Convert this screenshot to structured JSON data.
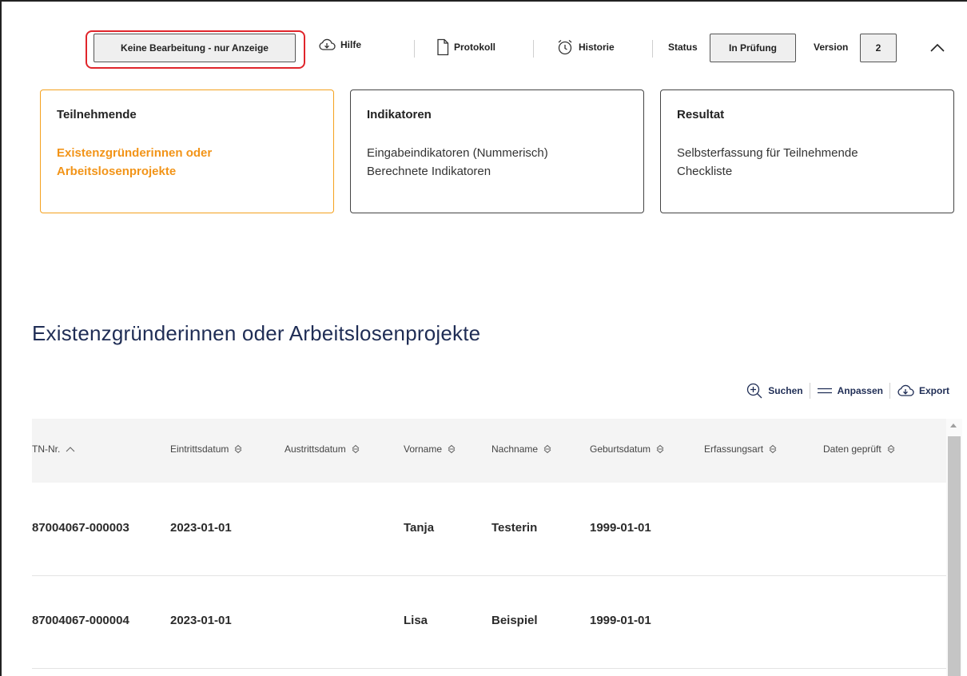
{
  "toolbar": {
    "mode_button": "Keine Bearbeitung - nur Anzeige",
    "help": "Hilfe",
    "protocol": "Protokoll",
    "history": "Historie",
    "status_label": "Status",
    "status_value": "In Prüfung",
    "version_label": "Version",
    "version_value": "2"
  },
  "cards": [
    {
      "title": "Teilnehmende",
      "links": [
        "Existenzgründerinnen oder Arbeitslosenprojekte"
      ],
      "active": true
    },
    {
      "title": "Indikatoren",
      "links": [
        "Eingabeindikatoren (Nummerisch)",
        "Berechnete Indikatoren"
      ],
      "active": false
    },
    {
      "title": "Resultat",
      "links": [
        "Selbsterfassung für Teilnehmende",
        "Checkliste"
      ],
      "active": false
    }
  ],
  "page_title": "Existenzgründerinnen oder Arbeitslosenprojekte",
  "table_actions": {
    "search": "Suchen",
    "customize": "Anpassen",
    "export": "Export"
  },
  "table": {
    "columns": [
      "TN-Nr.",
      "Eintrittsdatum",
      "Austrittsdatum",
      "Vorname",
      "Nachname",
      "Geburtsdatum",
      "Erfassungsart",
      "Daten geprüft"
    ],
    "rows": [
      [
        "87004067-000003",
        "2023-01-01",
        "",
        "Tanja",
        "Testerin",
        "1999-01-01",
        "",
        ""
      ],
      [
        "87004067-000004",
        "2023-01-01",
        "",
        "Lisa",
        "Beispiel",
        "1999-01-01",
        "",
        ""
      ]
    ]
  },
  "colors": {
    "accent": "#f29418",
    "navy": "#1f2d55",
    "highlight": "#e0252b"
  }
}
